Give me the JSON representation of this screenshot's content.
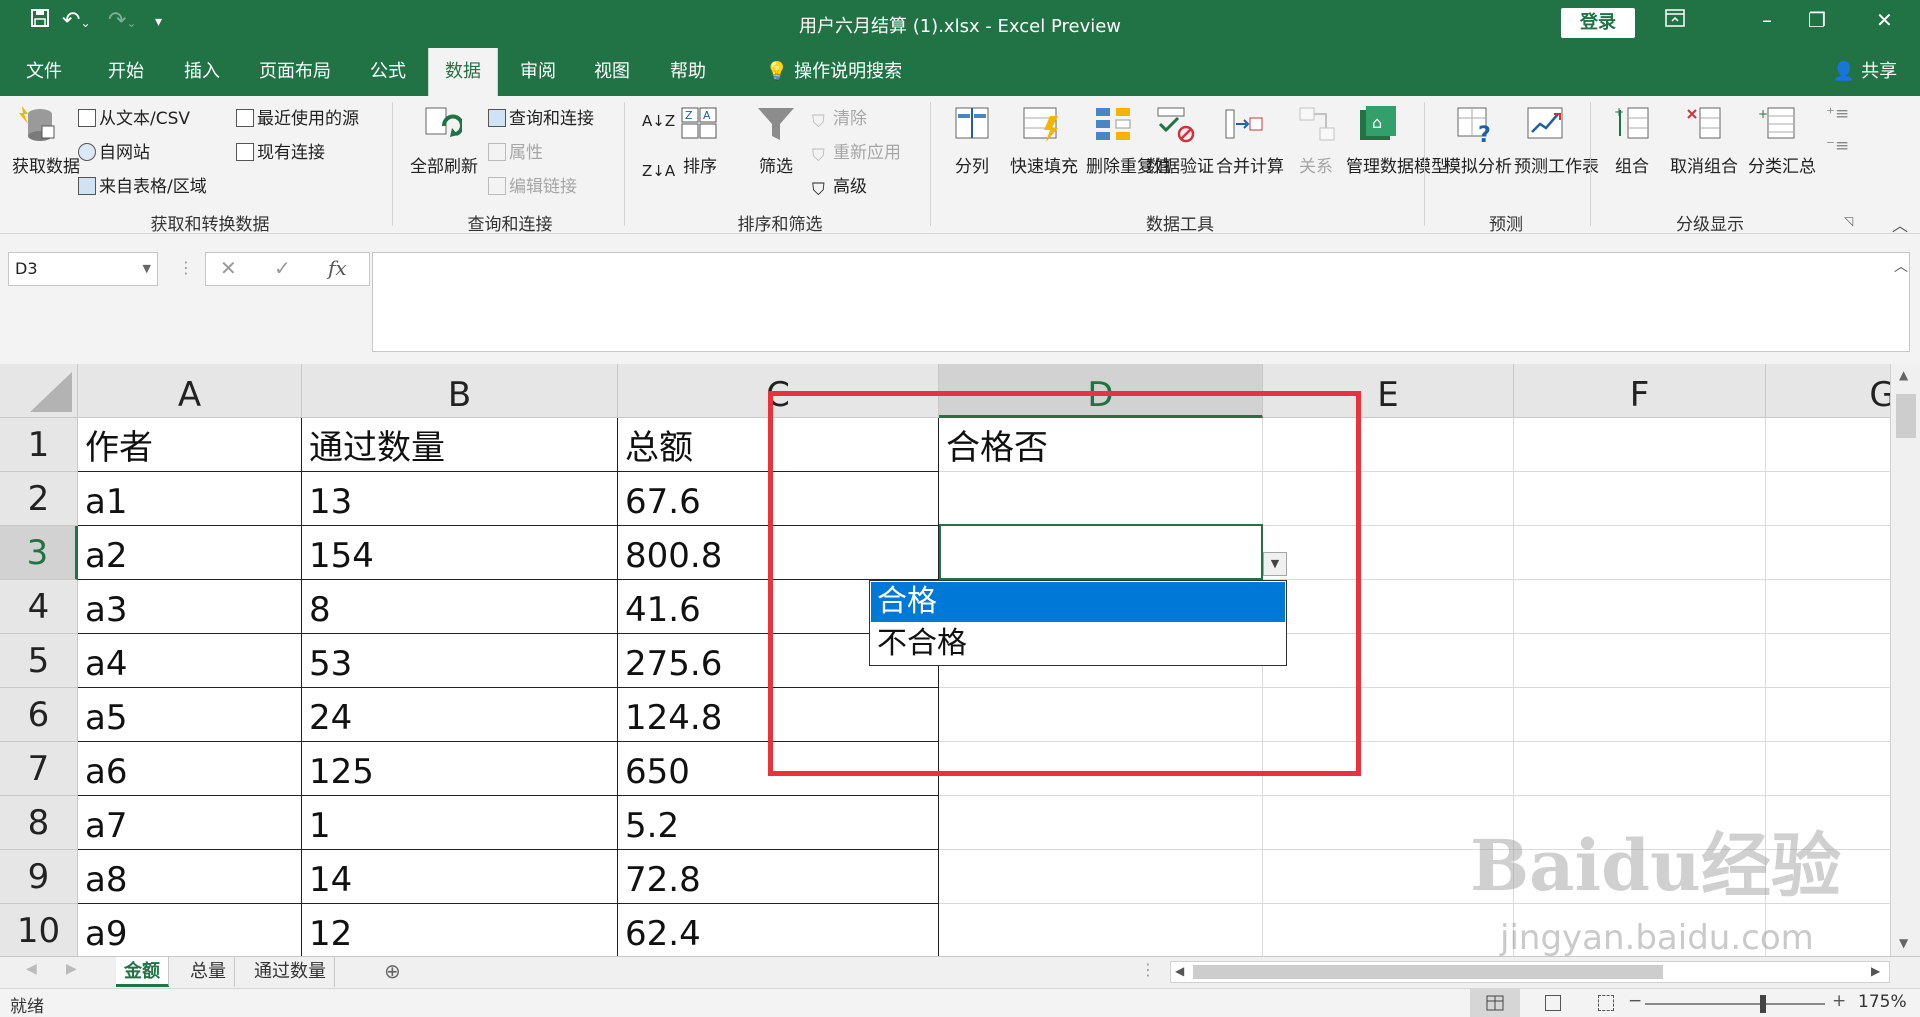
{
  "titlebar": {
    "title": "用户六月结算 (1).xlsx  -  Excel Preview",
    "login": "登录"
  },
  "tabs": [
    "文件",
    "开始",
    "插入",
    "页面布局",
    "公式",
    "数据",
    "审阅",
    "视图",
    "帮助",
    "操作说明搜索"
  ],
  "active_tab": "数据",
  "share": "共享",
  "ribbon": {
    "get_data": "获取数据",
    "from_text": "从文本/CSV",
    "from_web": "自网站",
    "from_table": "来自表格/区域",
    "recent_sources": "最近使用的源",
    "existing_conn": "现有连接",
    "group_get": "获取和转换数据",
    "refresh_all": "全部刷新",
    "queries_conn": "查询和连接",
    "properties": "属性",
    "edit_links": "编辑链接",
    "group_queries": "查询和连接",
    "sort": "排序",
    "filter": "筛选",
    "clear": "清除",
    "reapply": "重新应用",
    "advanced": "高级",
    "group_sort": "排序和筛选",
    "text_to_col": "分列",
    "flash_fill": "快速填充",
    "remove_dup": "删除重复值",
    "data_validation": "数据验证",
    "consolidate": "合并计算",
    "relations": "关系",
    "data_model": "管理数据模型",
    "group_tools": "数据工具",
    "what_if": "模拟分析",
    "forecast": "预测工作表",
    "group_forecast": "预测",
    "group": "组合",
    "ungroup": "取消组合",
    "subtotal": "分类汇总",
    "group_outline": "分级显示"
  },
  "namebox": "D3",
  "columns": [
    "A",
    "B",
    "C",
    "D",
    "E",
    "F",
    "G"
  ],
  "rows": [
    [
      "作者",
      "通过数量",
      "总额",
      "合格否"
    ],
    [
      "a1",
      "13",
      "67.6",
      ""
    ],
    [
      "a2",
      "154",
      "800.8",
      ""
    ],
    [
      "a3",
      "8",
      "41.6",
      ""
    ],
    [
      "a4",
      "53",
      "275.6",
      ""
    ],
    [
      "a5",
      "24",
      "124.8",
      ""
    ],
    [
      "a6",
      "125",
      "650",
      ""
    ],
    [
      "a7",
      "1",
      "5.2",
      ""
    ],
    [
      "a8",
      "14",
      "72.8",
      ""
    ],
    [
      "a9",
      "12",
      "62.4",
      ""
    ]
  ],
  "dropdown": [
    "合格",
    "不合格"
  ],
  "sheets": [
    "金额",
    "总量",
    "通过数量"
  ],
  "active_sheet": "金额",
  "status": "就绪",
  "zoom": "175%",
  "watermark": "Baidu经验",
  "watermark_url": "jingyan.baidu.com",
  "colors": {
    "accent": "#217346",
    "highlight": "#0078d7",
    "redbox": "#e8333a"
  }
}
